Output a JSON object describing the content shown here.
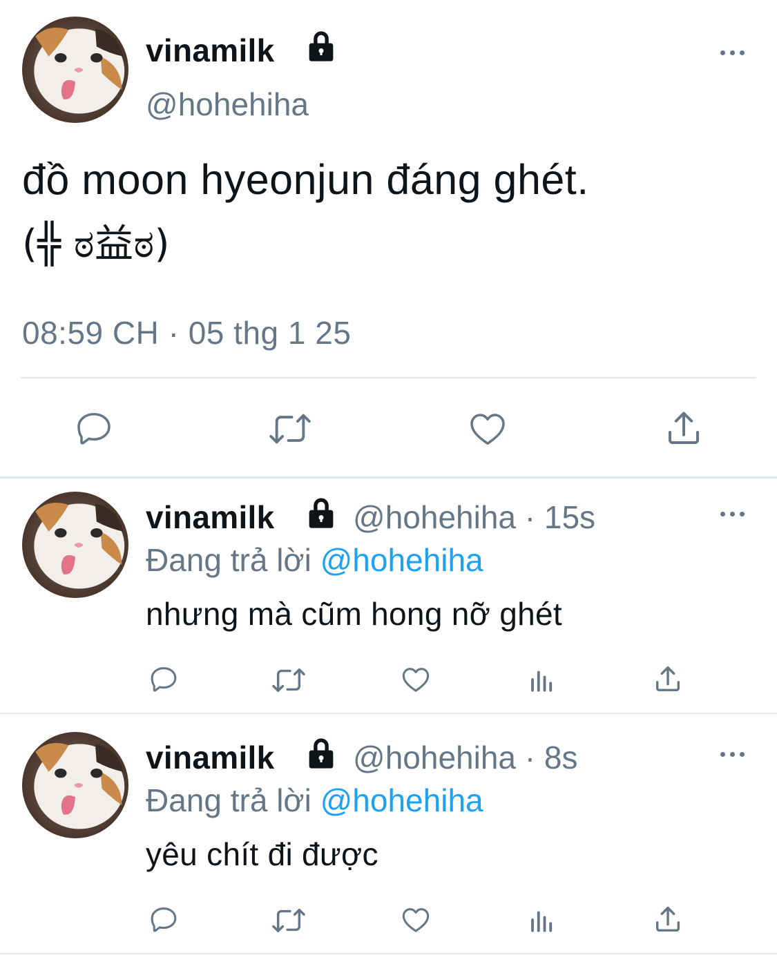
{
  "main_tweet": {
    "display_name": "vinamilk",
    "handle": "@hohehiha",
    "text_line1": "đồ moon hyeonjun đáng ghét.",
    "text_line2": "(╬ ಠ益ಠ)",
    "timestamp": "08:59 CH · 05 thg 1 25"
  },
  "replies": [
    {
      "display_name": "vinamilk",
      "handle_time": "@hohehiha · 15s",
      "replying_prefix": "Đang trả lời",
      "replying_mention": "@hohehiha",
      "text": "nhưng mà cũm hong nỡ ghét"
    },
    {
      "display_name": "vinamilk",
      "handle_time": "@hohehiha · 8s",
      "replying_prefix": "Đang trả lời",
      "replying_mention": "@hohehiha",
      "text": "yêu chít đi được"
    }
  ],
  "colors": {
    "text": "#0f1419",
    "secondary": "#657786",
    "mention": "#1da1f2",
    "divider": "#e1e8ed"
  },
  "icons": [
    "lock-icon",
    "more-icon",
    "reply-icon",
    "retweet-icon",
    "like-icon",
    "share-icon",
    "analytics-icon"
  ]
}
